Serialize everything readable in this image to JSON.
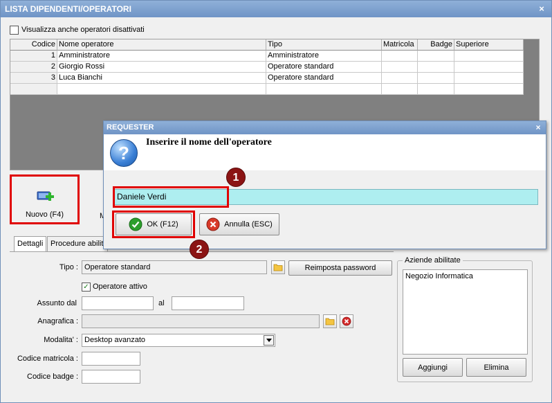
{
  "window": {
    "title": "LISTA DIPENDENTI/OPERATORI",
    "close_label": "×",
    "show_disabled_label": "Visualizza anche operatori disattivati"
  },
  "grid": {
    "columns": [
      "Codice",
      "Nome operatore",
      "Tipo",
      "Matricola",
      "Badge",
      "Superiore"
    ],
    "rows": [
      {
        "codice": "1",
        "nome": "Amministratore",
        "tipo": "Amministratore",
        "matricola": "",
        "badge": "",
        "superiore": ""
      },
      {
        "codice": "2",
        "nome": "Giorgio Rossi",
        "tipo": "Operatore standard",
        "matricola": "",
        "badge": "",
        "superiore": ""
      },
      {
        "codice": "3",
        "nome": "Luca Bianchi",
        "tipo": "Operatore standard",
        "matricola": "",
        "badge": "",
        "superiore": ""
      }
    ]
  },
  "toolbar": {
    "new_label": "Nuovo (F4)",
    "modify_partial": "M"
  },
  "tabs": [
    {
      "label": "Dettagli"
    },
    {
      "label": "Procedure abilita"
    }
  ],
  "details": {
    "tipo_label": "Tipo :",
    "tipo_value": "Operatore standard",
    "reset_password_label": "Reimposta password",
    "active_label": "Operatore attivo",
    "assunto_label": "Assunto dal",
    "assunto_value": "",
    "al_label": "al",
    "al_value": "",
    "anagrafica_label": "Anagrafica :",
    "anagrafica_value": "",
    "modalita_label": "Modalita' :",
    "modalita_value": "Desktop avanzato",
    "matricola_label": "Codice matricola :",
    "matricola_value": "",
    "badge_label": "Codice badge :",
    "badge_value": ""
  },
  "companies": {
    "title": "Aziende abilitate",
    "items": [
      "Negozio Informatica"
    ],
    "add_label": "Aggiungi",
    "delete_label": "Elimina"
  },
  "dialog": {
    "title": "REQUESTER",
    "close_label": "×",
    "question_glyph": "?",
    "prompt": "Inserire il nome dell'operatore",
    "input_value": "Daniele Verdi",
    "ok_label": "OK (F12)",
    "cancel_label": "Annulla (ESC)"
  },
  "annotations": {
    "marker_1": "1",
    "marker_2": "2"
  },
  "colors": {
    "title_bar": "#7a9dcc",
    "input_highlight": "#aeeef0",
    "annotation_red": "#e00000",
    "marker_fill": "#8b1414"
  }
}
